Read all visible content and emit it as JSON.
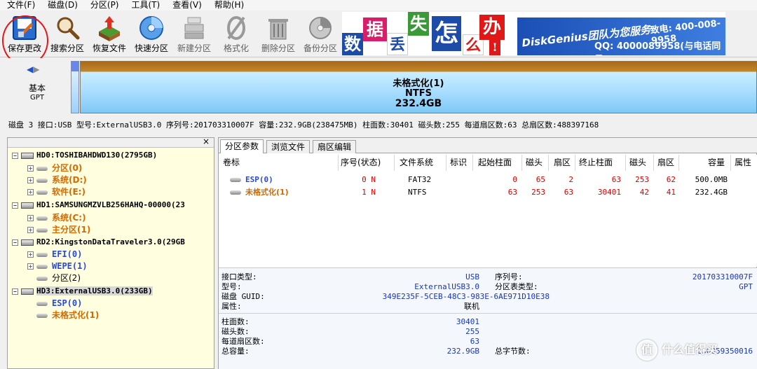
{
  "menu": [
    "文件(F)",
    "磁盘(D)",
    "分区(P)",
    "工具(T)",
    "查看(V)",
    "帮助(H)"
  ],
  "toolbar": {
    "items": [
      {
        "label": "保存更改",
        "icon": "save-changes-icon"
      },
      {
        "label": "搜索分区",
        "icon": "magnifier-icon"
      },
      {
        "label": "恢复文件",
        "icon": "recover-files-icon"
      },
      {
        "label": "快速分区",
        "icon": "quick-partition-disc-icon"
      },
      {
        "label": "新建分区",
        "icon": "new-partition-icon"
      },
      {
        "label": "格式化",
        "icon": "format-icon"
      },
      {
        "label": "删除分区",
        "icon": "trash-icon"
      },
      {
        "label": "备份分区",
        "icon": "backup-disc-icon"
      }
    ]
  },
  "banner": {
    "tiles": [
      "数",
      "据",
      "丢",
      "失",
      "怎",
      "么",
      "办",
      "!"
    ],
    "brand": "DiskGenius团队为您服务",
    "hotline": "致电: 400-008-9958",
    "qq": "QQ: 4000089958(与电话同号)"
  },
  "disk_map": {
    "disk_type": "基本",
    "disk_style": "GPT",
    "partition_name": "未格式化(1)",
    "partition_fs": "NTFS",
    "partition_size": "232.4GB"
  },
  "disk_info": "磁盘 3 接口:USB  型号:ExternalUSB3.0  序列号:201703310007F  容量:232.9GB(238475MB)  柱面数:30401  磁头数:255  每道扇区数:63  总扇区数:488397168",
  "tree": {
    "close": "×",
    "nodes": [
      {
        "text": "HD0:TOSHIBAHDWD130(2795GB)",
        "kind": "disk"
      },
      {
        "text": "分区(0)",
        "kind": "part-orange"
      },
      {
        "text": "系统(D:)",
        "kind": "part-orange"
      },
      {
        "text": "软件(E:)",
        "kind": "part-orange"
      },
      {
        "text": "HD1:SAMSUNGMZVLB256HAHQ-00000(23",
        "kind": "disk"
      },
      {
        "text": "系统(C:)",
        "kind": "part-orange"
      },
      {
        "text": "主分区(1)",
        "kind": "part-orange"
      },
      {
        "text": "RD2:KingstonDataTraveler3.0(29GB",
        "kind": "disk"
      },
      {
        "text": "EFI(0)",
        "kind": "part-blue"
      },
      {
        "text": "WEPE(1)",
        "kind": "part-blue"
      },
      {
        "text": "分区(2)",
        "kind": "part-plain"
      },
      {
        "text": "HD3:ExternalUSB3.0(233GB)",
        "kind": "disk"
      },
      {
        "text": "ESP(0)",
        "kind": "part-blue"
      },
      {
        "text": "未格式化(1)",
        "kind": "part-orange"
      }
    ]
  },
  "tabs": [
    "分区参数",
    "浏览文件",
    "扇区编辑"
  ],
  "table": {
    "headers": [
      "卷标",
      "序号(状态)",
      "文件系统",
      "标识",
      "起始柱面",
      "磁头",
      "扇区",
      "终止柱面",
      "磁头",
      "扇区",
      "容量",
      "属性"
    ],
    "rows": [
      [
        "ESP(0)",
        "0 N",
        "FAT32",
        "",
        "0",
        "65",
        "2",
        "63",
        "253",
        "62",
        "500.0MB",
        ""
      ],
      [
        "未格式化(1)",
        "1 N",
        "NTFS",
        "",
        "63",
        "253",
        "63",
        "30401",
        "42",
        "41",
        "232.4GB",
        ""
      ]
    ]
  },
  "info": {
    "interface_label": "接口类型:",
    "interface_value": "USB",
    "serial_label": "序列号:",
    "serial_value": "201703310007F",
    "model_label": "型号:",
    "model_value": "ExternalUSB3.0",
    "pt_label": "分区表类型:",
    "pt_value": "GPT",
    "guid_label": "磁盘 GUID:",
    "guid_value": "349E235F-5CEB-48C3-983E-6AE971D10E38",
    "attr_label": "属性:",
    "attr_value": "联机",
    "cyl_label": "柱面数:",
    "cyl_value": "30401",
    "heads_label": "磁头数:",
    "heads_value": "255",
    "spt_label": "每道扇区数:",
    "spt_value": "63",
    "cap_label": "总容量:",
    "cap_value": "232.9GB",
    "bytes_label": "总字节数:",
    "bytes_value": "250059350016"
  },
  "watermark": "什么值得买",
  "colors": {
    "accent_red": "#e01818",
    "value_blue": "#1a36b8",
    "orange": "#d46a00"
  }
}
